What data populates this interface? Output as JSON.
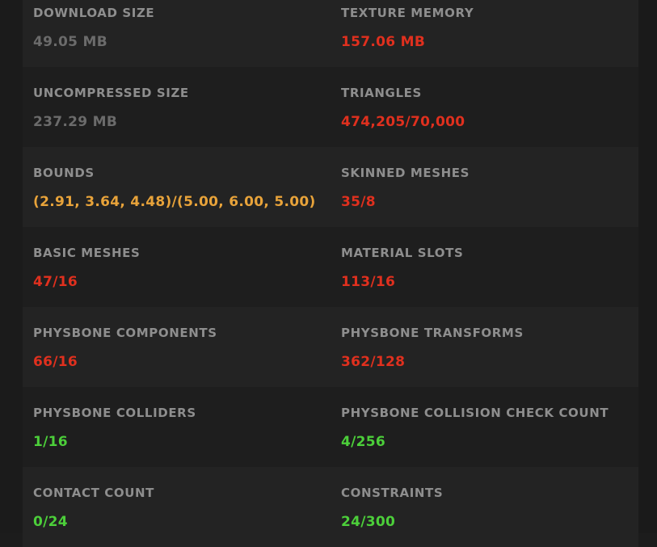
{
  "colors": {
    "background": "#1c1c1c",
    "label": "#8e8e8e",
    "neutral": "#6b6b6b",
    "bad": "#e0301e",
    "warning": "#e8a33a",
    "good": "#4ccf3a"
  },
  "stats": [
    {
      "left": {
        "label": "DOWNLOAD SIZE",
        "value": "49.05 MB",
        "status": "neutral"
      },
      "right": {
        "label": "TEXTURE MEMORY",
        "value": "157.06 MB",
        "status": "bad"
      }
    },
    {
      "left": {
        "label": "UNCOMPRESSED SIZE",
        "value": "237.29 MB",
        "status": "neutral"
      },
      "right": {
        "label": "TRIANGLES",
        "value": "474,205/70,000",
        "status": "bad"
      }
    },
    {
      "left": {
        "label": "BOUNDS",
        "value": "(2.91, 3.64, 4.48)/(5.00, 6.00, 5.00)",
        "status": "warning"
      },
      "right": {
        "label": "SKINNED MESHES",
        "value": "35/8",
        "status": "bad"
      }
    },
    {
      "left": {
        "label": "BASIC MESHES",
        "value": "47/16",
        "status": "bad"
      },
      "right": {
        "label": "MATERIAL SLOTS",
        "value": "113/16",
        "status": "bad"
      }
    },
    {
      "left": {
        "label": "PHYSBONE COMPONENTS",
        "value": "66/16",
        "status": "bad"
      },
      "right": {
        "label": "PHYSBONE TRANSFORMS",
        "value": "362/128",
        "status": "bad"
      }
    },
    {
      "left": {
        "label": "PHYSBONE COLLIDERS",
        "value": "1/16",
        "status": "good"
      },
      "right": {
        "label": "PHYSBONE COLLISION CHECK COUNT",
        "value": "4/256",
        "status": "good"
      }
    },
    {
      "left": {
        "label": "CONTACT COUNT",
        "value": "0/24",
        "status": "good"
      },
      "right": {
        "label": "CONSTRAINTS",
        "value": "24/300",
        "status": "good"
      }
    }
  ]
}
